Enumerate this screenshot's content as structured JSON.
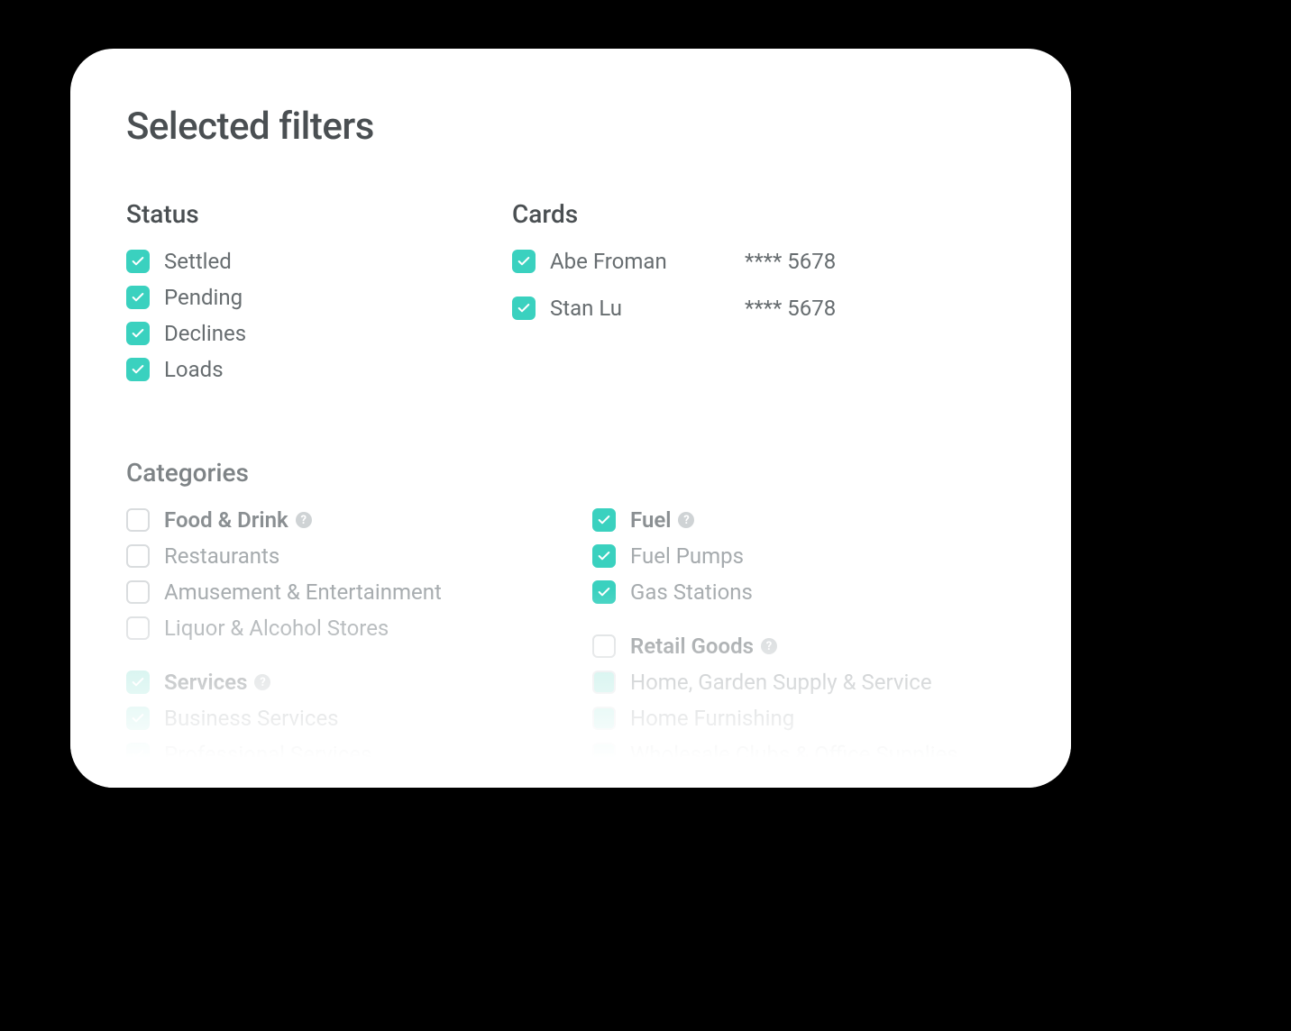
{
  "title": "Selected filters",
  "colors": {
    "accent": "#3ad1bf"
  },
  "status": {
    "heading": "Status",
    "items": [
      {
        "label": "Settled",
        "checked": true
      },
      {
        "label": "Pending",
        "checked": true
      },
      {
        "label": "Declines",
        "checked": true
      },
      {
        "label": "Loads",
        "checked": true
      }
    ]
  },
  "cards": {
    "heading": "Cards",
    "items": [
      {
        "name": "Abe Froman",
        "masked": "**** 5678",
        "checked": true
      },
      {
        "name": "Stan Lu",
        "masked": "**** 5678",
        "checked": true
      }
    ]
  },
  "categories": {
    "heading": "Categories",
    "left": [
      {
        "name": "Food & Drink",
        "checked": false,
        "help": true,
        "children": [
          {
            "label": "Restaurants",
            "checked": false
          },
          {
            "label": "Amusement & Entertainment",
            "checked": false
          },
          {
            "label": "Liquor & Alcohol Stores",
            "checked": false
          }
        ]
      },
      {
        "name": "Services",
        "checked": true,
        "help": true,
        "children": [
          {
            "label": "Business Services",
            "checked": true
          },
          {
            "label": "Professional Services",
            "checked": true
          }
        ]
      }
    ],
    "right": [
      {
        "name": "Fuel",
        "checked": true,
        "help": true,
        "children": [
          {
            "label": "Fuel Pumps",
            "checked": true
          },
          {
            "label": "Gas Stations",
            "checked": true
          }
        ]
      },
      {
        "name": "Retail Goods",
        "checked": false,
        "help": true,
        "children": [
          {
            "label": "Home, Garden Supply & Service",
            "checked": false
          },
          {
            "label": "Home Furnishing",
            "checked": false
          },
          {
            "label": "Wholesale Clubs & Office Supplies",
            "checked": false
          }
        ]
      }
    ]
  }
}
